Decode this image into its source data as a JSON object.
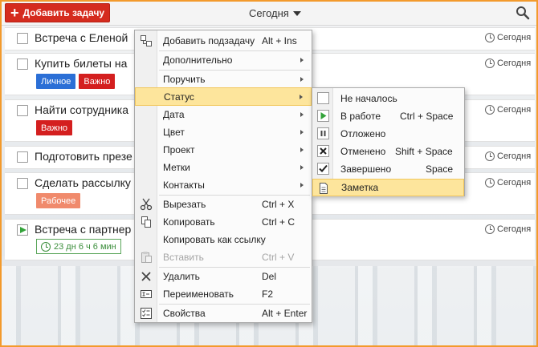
{
  "toolbar": {
    "add_task_label": "Добавить задачу",
    "filter_label": "Сегодня",
    "search_icon": "search-icon"
  },
  "tasks": [
    {
      "title": "Встреча с Еленой",
      "due": "Сегодня",
      "state": "unchecked",
      "tags": []
    },
    {
      "title": "Купить билеты на",
      "due": "Сегодня",
      "state": "unchecked",
      "tags": [
        {
          "label": "Личное",
          "color": "#2b6fd6"
        },
        {
          "label": "Важно",
          "color": "#d41f1f"
        }
      ]
    },
    {
      "title": "Найти сотрудника",
      "due": "Сегодня",
      "state": "unchecked",
      "tags": [
        {
          "label": "Важно",
          "color": "#d41f1f"
        }
      ]
    },
    {
      "title": "Подготовить презе",
      "due": "Сегодня",
      "state": "unchecked",
      "tags": []
    },
    {
      "title": "Сделать рассылку",
      "due": "Сегодня",
      "state": "unchecked",
      "tags": [
        {
          "label": "Рабочее",
          "color": "#f08a6c"
        }
      ]
    },
    {
      "title": "Встреча с партнер",
      "due": "Сегодня",
      "state": "in-progress",
      "timer": "23 дн 6 ч 6 мин"
    }
  ],
  "context_menu": {
    "items": [
      {
        "label": "Добавить подзадачу",
        "shortcut": "Alt + Ins",
        "icon": "add-subtask-icon"
      },
      {
        "label": "Дополнительно",
        "submenu": true
      },
      {
        "label": "Поручить",
        "submenu": true
      },
      {
        "label": "Статус",
        "submenu": true,
        "highlighted": true
      },
      {
        "label": "Дата",
        "submenu": true
      },
      {
        "label": "Цвет",
        "submenu": true
      },
      {
        "label": "Проект",
        "submenu": true
      },
      {
        "label": "Метки",
        "submenu": true
      },
      {
        "label": "Контакты",
        "submenu": true
      },
      {
        "label": "Вырезать",
        "shortcut": "Ctrl + X",
        "icon": "scissors-icon"
      },
      {
        "label": "Копировать",
        "shortcut": "Ctrl + C",
        "icon": "copy-icon"
      },
      {
        "label": "Копировать как ссылку"
      },
      {
        "label": "Вставить",
        "shortcut": "Ctrl + V",
        "icon": "paste-icon",
        "disabled": true
      },
      {
        "label": "Удалить",
        "shortcut": "Del",
        "icon": "delete-icon"
      },
      {
        "label": "Переименовать",
        "shortcut": "F2",
        "icon": "rename-icon"
      },
      {
        "label": "Свойства",
        "shortcut": "Alt + Enter",
        "icon": "properties-icon"
      }
    ]
  },
  "status_menu": {
    "items": [
      {
        "label": "Не началось",
        "icon": "empty-checkbox-icon"
      },
      {
        "label": "В работе",
        "shortcut": "Ctrl + Space",
        "icon": "play-icon"
      },
      {
        "label": "Отложено",
        "icon": "pause-icon"
      },
      {
        "label": "Отменено",
        "shortcut": "Shift + Space",
        "icon": "cancel-icon"
      },
      {
        "label": "Завершено",
        "shortcut": "Space",
        "icon": "check-icon"
      },
      {
        "label": "Заметка",
        "icon": "note-icon",
        "highlighted": true
      }
    ]
  },
  "colors": {
    "accent": "#d52b1e",
    "frame": "#f39a2c",
    "highlight": "#fde59c",
    "in_progress": "#33a33a"
  }
}
